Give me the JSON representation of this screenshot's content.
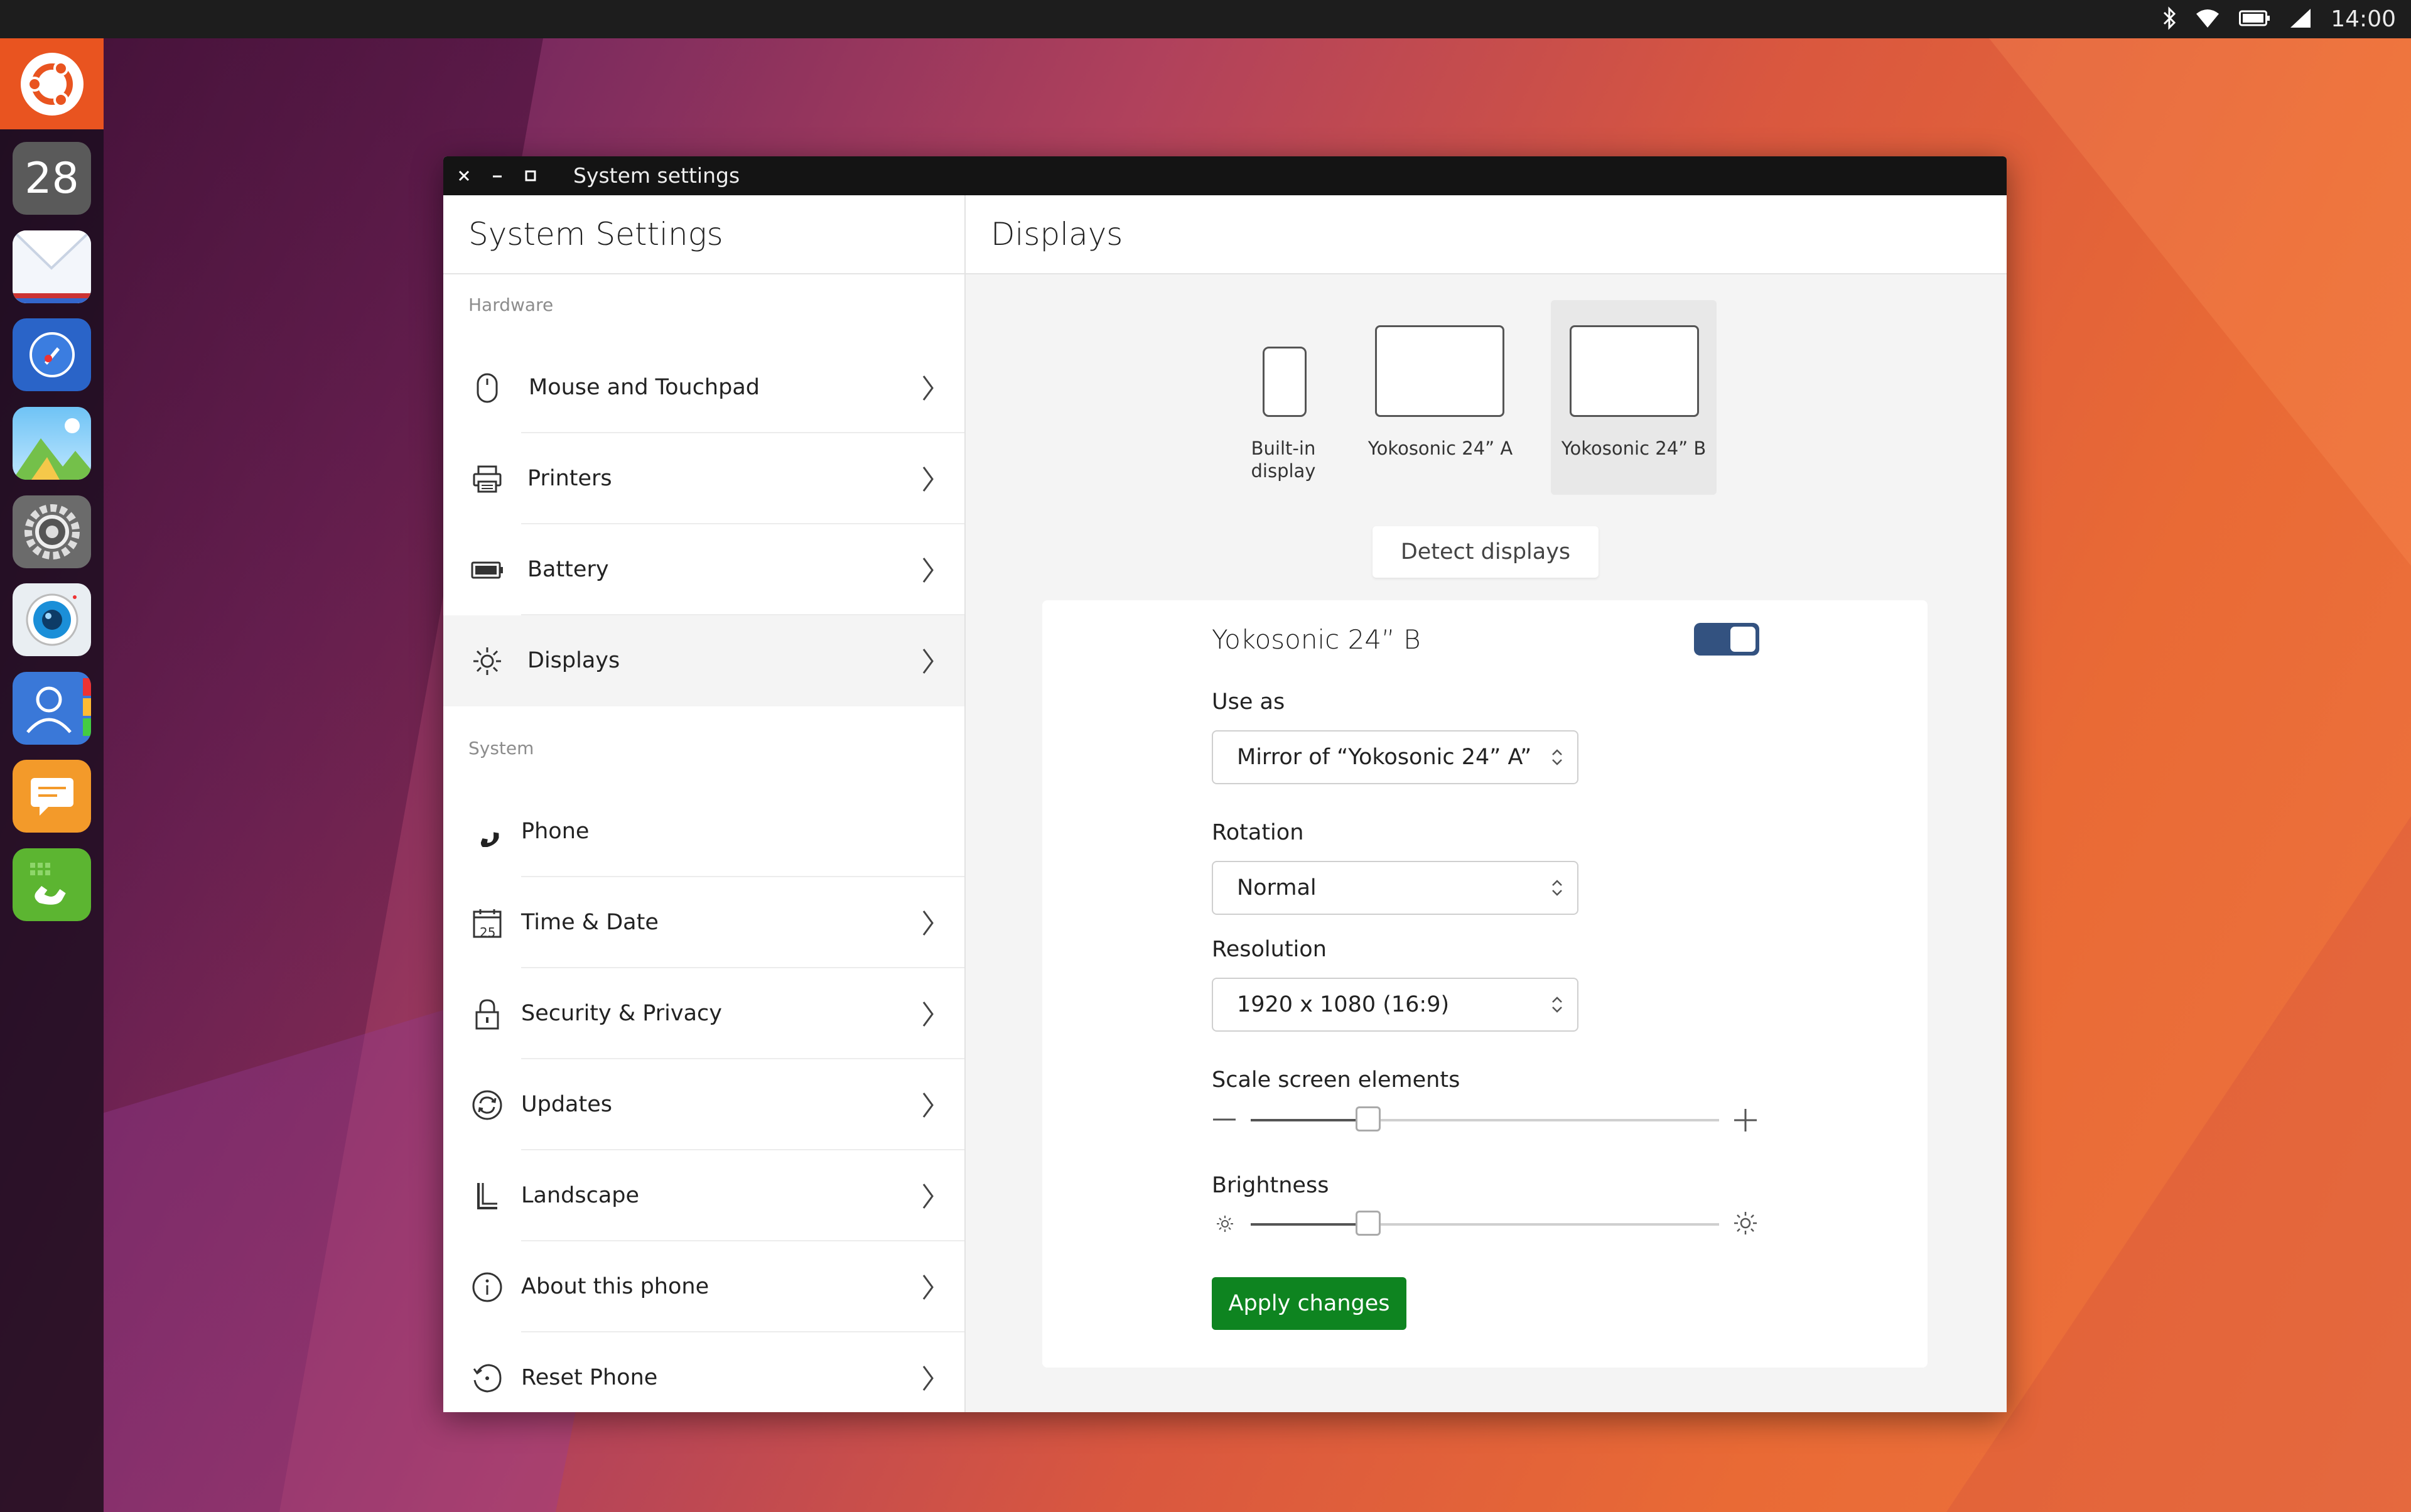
{
  "statusbar": {
    "time": "14:00",
    "icons": [
      "bluetooth-icon",
      "wifi-icon",
      "battery-icon",
      "signal-icon"
    ]
  },
  "launcher": {
    "calendar_day": "28",
    "items": [
      "ubuntu-logo-icon",
      "calendar-icon",
      "mail-icon",
      "browser-icon",
      "gallery-icon",
      "settings-icon",
      "camera-icon",
      "contacts-icon",
      "messaging-icon",
      "phone-app-icon"
    ]
  },
  "window": {
    "title": "System settings"
  },
  "left_panel": {
    "title": "System Settings",
    "sections": [
      {
        "label": "Hardware",
        "items": [
          {
            "label": "Mouse and Touchpad",
            "icon": "mouse-icon"
          },
          {
            "label": "Printers",
            "icon": "printer-icon"
          },
          {
            "label": "Battery",
            "icon": "battery-icon"
          },
          {
            "label": "Displays",
            "icon": "brightness-icon",
            "active": true
          }
        ]
      },
      {
        "label": "System",
        "items": [
          {
            "label": "Phone",
            "icon": "phone-icon"
          },
          {
            "label": "Time & Date",
            "icon": "calendar-icon",
            "icon_text": "25"
          },
          {
            "label": "Security & Privacy",
            "icon": "lock-icon"
          },
          {
            "label": "Updates",
            "icon": "sync-icon"
          },
          {
            "label": "Landscape",
            "icon": "landscape-icon"
          },
          {
            "label": "About this phone",
            "icon": "info-icon"
          },
          {
            "label": "Reset Phone",
            "icon": "reset-icon"
          }
        ]
      }
    ]
  },
  "right_panel": {
    "title": "Displays",
    "displays": [
      {
        "line1": "Built-in",
        "line2": "display"
      },
      {
        "label": "Yokosonic 24” A"
      },
      {
        "label": "Yokosonic 24” B",
        "selected": true
      }
    ],
    "detect_label": "Detect displays",
    "card": {
      "display_name": "Yokosonic 24” B",
      "enabled": true,
      "use_as_label": "Use as",
      "use_as_value": "Mirror of “Yokosonic 24” A”",
      "rotation_label": "Rotation",
      "rotation_value": "Normal",
      "resolution_label": "Resolution",
      "resolution_value": "1920 x 1080 (16:9)",
      "scale_label": "Scale screen elements",
      "scale_value": 0.25,
      "brightness_label": "Brightness",
      "brightness_value": 0.25,
      "apply_label": "Apply changes"
    },
    "colors": {
      "accent_toggle": "#335280",
      "apply_button": "#0e8420",
      "brand_orange": "#e95420"
    }
  }
}
